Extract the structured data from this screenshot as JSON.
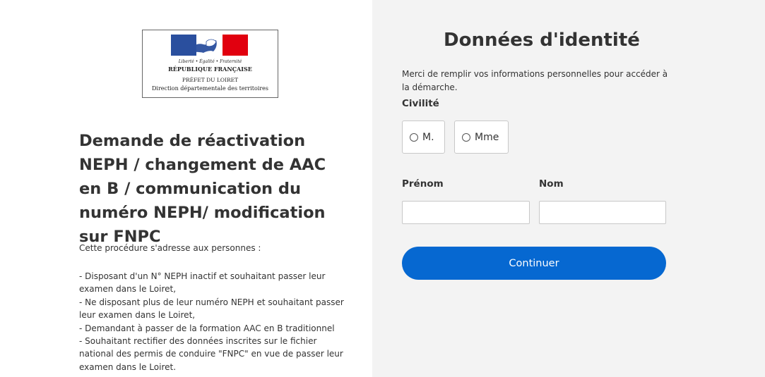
{
  "logo": {
    "motto": "Liberté • Égalité • Fraternité",
    "republic": "RÉPUBLIQUE FRANÇAISE",
    "prefet": "PRÉFET DU LOIRET",
    "direction": "Direction départementale des territoires",
    "flag_colors": [
      "#2a4f9e",
      "#ffffff",
      "#e1000f"
    ]
  },
  "procedure": {
    "title": "Demande de réactivation NEPH / changement de AAC en B / communication du numéro NEPH/ modification sur FNPC",
    "intro": "Cette procédure s'adresse aux personnes :",
    "items": [
      "- Disposant d'un N° NEPH inactif et souhaitant passer leur examen dans le Loiret,",
      "- Ne disposant plus de leur numéro NEPH et souhaitant passer leur examen dans le Loiret,",
      "- Demandant à passer de la formation AAC en B traditionnel",
      "- Souhaitant rectifier des données inscrites sur le fichier national des permis de conduire \"FNPC\" en vue de passer leur examen dans le Loiret."
    ]
  },
  "form": {
    "title": "Données d'identité",
    "description": "Merci de remplir vos informations personnelles pour accéder à la démarche.",
    "civilite_label": "Civilité",
    "civilite_options": [
      "M.",
      "Mme"
    ],
    "prenom_label": "Prénom",
    "prenom_value": "",
    "nom_label": "Nom",
    "nom_value": "",
    "submit_label": "Continuer",
    "accent_color": "#0668d1"
  }
}
